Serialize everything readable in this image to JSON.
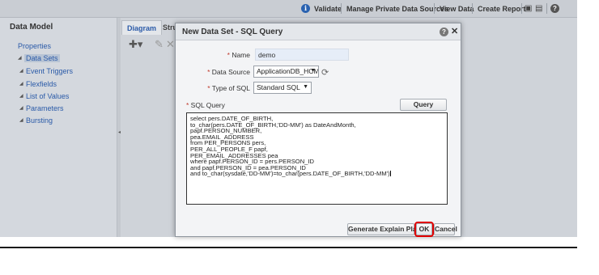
{
  "toolbar": {
    "validate_label": "Validate",
    "manage_params_label": "Manage Private Data Sources",
    "view_data_label": "View Data",
    "create_report_label": "Create Report",
    "info_icon": "i",
    "help_icon": "?"
  },
  "left_panel": {
    "title": "Data Model",
    "properties_label": "Properties",
    "items": [
      {
        "label": "Data Sets",
        "selected": true
      },
      {
        "label": "Event Triggers",
        "selected": false
      },
      {
        "label": "Flexfields",
        "selected": false
      },
      {
        "label": "List of Values",
        "selected": false
      },
      {
        "label": "Parameters",
        "selected": false
      },
      {
        "label": "Bursting",
        "selected": false
      }
    ]
  },
  "tabs": [
    {
      "label": "Diagram"
    },
    {
      "label": "Structu"
    }
  ],
  "dialog": {
    "title": "New Data Set - SQL Query",
    "name_label": "Name",
    "name_value": "demo",
    "data_source_label": "Data Source",
    "data_source_value": "ApplicationDB_HCM",
    "type_of_sql_label": "Type of SQL",
    "type_of_sql_value": "Standard SQL",
    "sql_query_label": "SQL Query",
    "query_builder_label": "Query Builder",
    "sql_lines": [
      "select pers.DATE_OF_BIRTH,",
      "to_char(pers.DATE_OF_BIRTH,'DD-MM') as DateAndMonth,",
      "papf.PERSON_NUMBER,",
      "pea.EMAIL_ADDRESS",
      "from PER_PERSONS pers,",
      "PER_ALL_PEOPLE_F papf,",
      "PER_EMAIL_ADDRESSES pea",
      "where papf.PERSON_ID = pers.PERSON_ID",
      "and papf.PERSON_ID = pea.PERSON_ID",
      "and to_char(sysdate,'DD-MM')=to_char(pers.DATE_OF_BIRTH,'DD-MM')"
    ],
    "generate_explain_plan_label": "Generate Explain Plan",
    "ok_label": "OK",
    "cancel_label": "Cancel",
    "highlight_color": "#e00000"
  }
}
